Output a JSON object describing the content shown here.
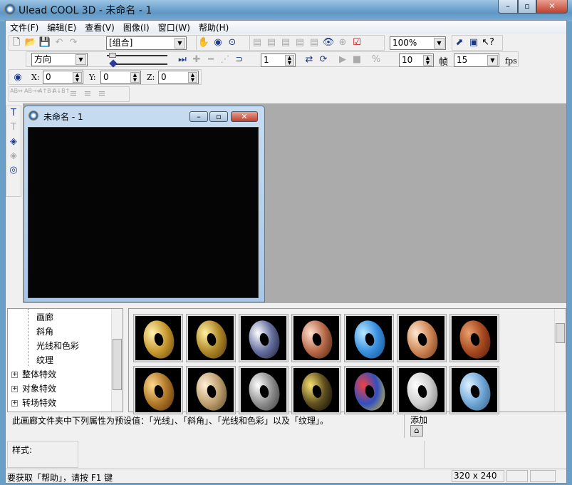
{
  "window": {
    "title": "Ulead COOL 3D - 未命名 - 1",
    "min": "–",
    "max": "▫",
    "close": "✕"
  },
  "menu": [
    "文件(F)",
    "编辑(E)",
    "查看(V)",
    "图像(I)",
    "窗口(W)",
    "帮助(H)"
  ],
  "toolbar": {
    "object_select": "[组合]",
    "zoom": "100%",
    "direction": "方向",
    "frame_value": "1",
    "frames": "10",
    "frame_label": "帧",
    "fps_value": "15",
    "fps_label": "fps"
  },
  "position": {
    "x_label": "X:",
    "x": "0",
    "y_label": "Y:",
    "y": "0",
    "z_label": "Z:",
    "z": "0"
  },
  "text_tools": [
    "AB↔",
    "AB→←",
    "A↑B↓",
    "A↓B↑"
  ],
  "child": {
    "title": "未命名 - 1"
  },
  "tree": {
    "items": [
      {
        "label": "画廊",
        "expand": false
      },
      {
        "label": "斜角",
        "expand": false
      },
      {
        "label": "光线和色彩",
        "expand": false
      },
      {
        "label": "纹理",
        "expand": false
      },
      {
        "label": "整体特效",
        "expand": true
      },
      {
        "label": "对象特效",
        "expand": true
      },
      {
        "label": "转场特效",
        "expand": true
      }
    ]
  },
  "thumbnails": [
    {
      "colors": [
        "#fff2b0",
        "#c89a30",
        "#5a3a08"
      ]
    },
    {
      "colors": [
        "#fff0a0",
        "#b08828",
        "#4a3008"
      ]
    },
    {
      "colors": [
        "#ffffff",
        "#6670a0",
        "#101828"
      ]
    },
    {
      "colors": [
        "#ffe0d0",
        "#b86a48",
        "#3a1808"
      ]
    },
    {
      "colors": [
        "#b8e8ff",
        "#3a90e0",
        "#104880"
      ]
    },
    {
      "colors": [
        "#ffe8d0",
        "#d08858",
        "#6a3010"
      ]
    },
    {
      "colors": [
        "#e8a070",
        "#a84a20",
        "#4a1808"
      ]
    },
    {
      "colors": [
        "#ffd890",
        "#b07828",
        "#4a2808"
      ]
    },
    {
      "colors": [
        "#fff0d8",
        "#c0a070",
        "#504020"
      ]
    },
    {
      "colors": [
        "#ffffff",
        "#909090",
        "#303030"
      ]
    },
    {
      "colors": [
        "#f8e070",
        "#605020",
        "#000000"
      ]
    },
    {
      "colors": [
        "#f04040",
        "#3050c0",
        "#f0d020"
      ]
    },
    {
      "colors": [
        "#ffffff",
        "#d0d0d0",
        "#707070"
      ]
    },
    {
      "colors": [
        "#e0f0ff",
        "#70a8d8",
        "#305878"
      ]
    }
  ],
  "description": "此画廊文件夹中下列属性为预设值：「光线」、「斜角」、「光线和色彩」以及「纹理」。",
  "add_label": "添加",
  "style_label": "样式:",
  "status": {
    "help": "要获取「帮助」，请按 F1 键",
    "size": "320 x 240"
  }
}
